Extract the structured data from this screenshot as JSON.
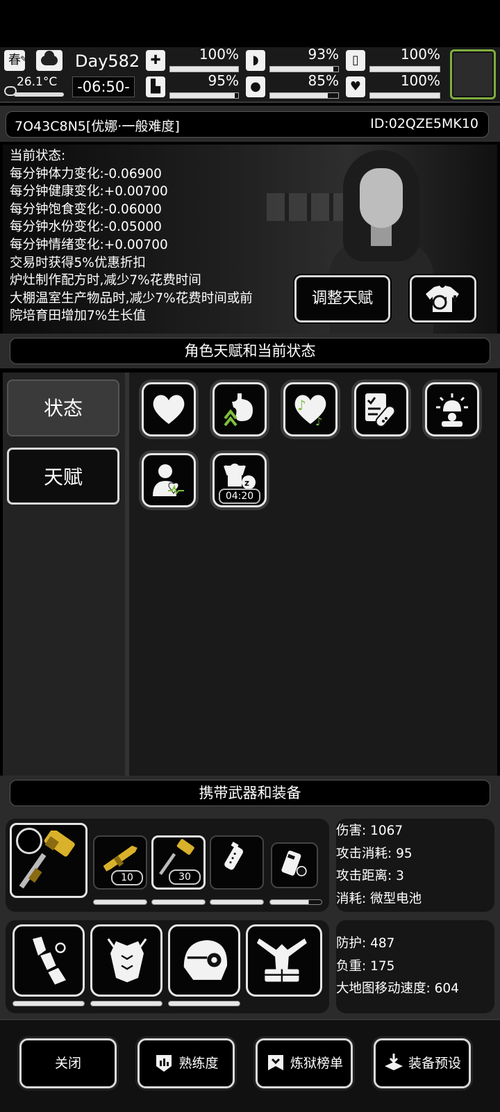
{
  "hud": {
    "season": "春",
    "temperature": "26.1°C",
    "day": "Day582",
    "time": "-06:50-",
    "stats": [
      {
        "name": "first-aid",
        "icon": "first-aid-icon",
        "value": "100%",
        "level": 1.0
      },
      {
        "name": "stomach",
        "icon": "stomach-icon",
        "value": "93%",
        "level": 0.93
      },
      {
        "name": "battery",
        "icon": "battery-icon",
        "value": "100%",
        "level": 1.0
      },
      {
        "name": "stamina",
        "icon": "boot-icon",
        "value": "95%",
        "level": 0.95
      },
      {
        "name": "water",
        "icon": "water-drop-icon",
        "value": "85%",
        "level": 0.85
      },
      {
        "name": "mood",
        "icon": "heart-icon",
        "value": "100%",
        "level": 1.0
      }
    ]
  },
  "header": {
    "name": "7O43C8N5[优娜·一般难度]",
    "id": "ID:02QZE5MK10"
  },
  "status": {
    "title": "当前状态:",
    "lines": [
      "每分钟体力变化:-0.06900",
      "每分钟健康变化:+0.00700",
      "每分钟饱食变化:-0.06000",
      "每分钟水份变化:-0.05000",
      "每分钟情绪变化:+0.00700",
      "交易时获得5%优惠折扣",
      "炉灶制作配方时,减少7%花费时间",
      "大棚温室生产物品时,减少7%花费时间或前",
      "院培育田增加7%生长值"
    ],
    "adjust_talent_button": "调整天赋"
  },
  "talent_section": {
    "title": "角色天赋和当前状态",
    "tabs": {
      "status": "状态",
      "talent": "天赋"
    },
    "icons": [
      {
        "name": "health-heart-icon"
      },
      {
        "name": "digestion-icon"
      },
      {
        "name": "music-heart-icon"
      },
      {
        "name": "medicine-icon"
      },
      {
        "name": "alarm-icon"
      },
      {
        "name": "person-heartbeat-icon"
      },
      {
        "name": "sleep-icon",
        "timer": "04:20"
      }
    ]
  },
  "equipment": {
    "title": "携带武器和装备",
    "weapon_stats": {
      "damage": "伤害: 1067",
      "attack_cost": "攻击消耗: 95",
      "attack_range": "攻击距离: 3",
      "consumption": "消耗: 微型电池"
    },
    "armor_stats": {
      "defense": "防护: 487",
      "weight": "负重: 175",
      "map_speed": "大地图移动速度: 604"
    },
    "weapon_counts": {
      "rifle": "10",
      "hammer": "30"
    },
    "durability": {
      "rifle": 1.0,
      "hammer": 1.0,
      "grenade": 1.0,
      "battery": 0.75,
      "arm_armor": 1.0,
      "chest_armor": 1.0,
      "helmet": 1.0
    }
  },
  "footer": {
    "close": "关闭",
    "proficiency": "熟练度",
    "ranking": "炼狱榜单",
    "equip_preset": "装备预设"
  }
}
